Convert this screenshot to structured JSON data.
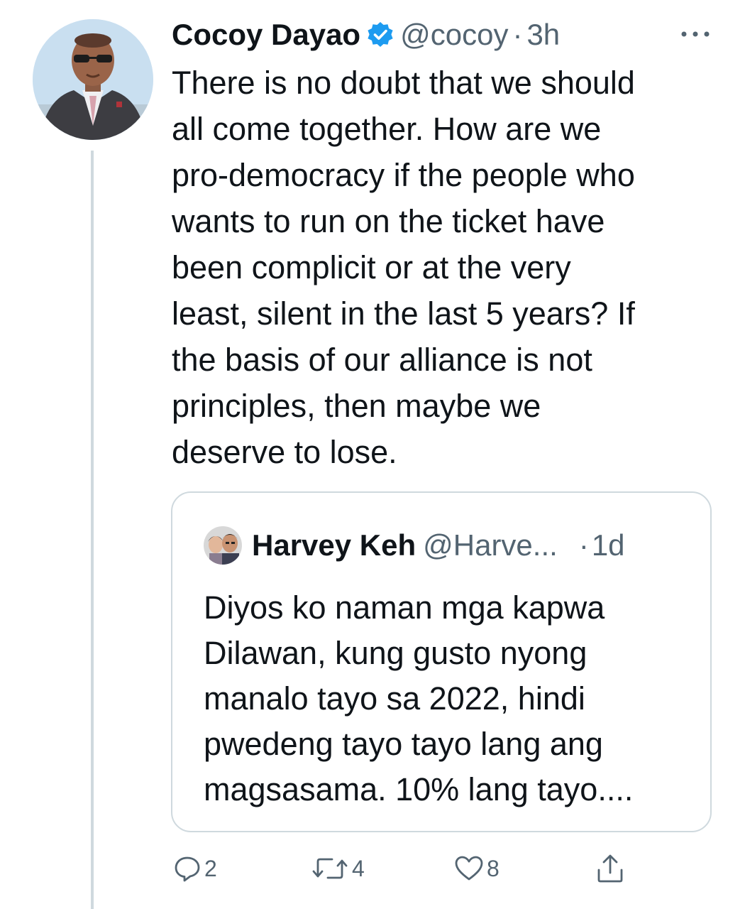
{
  "tweet": {
    "author": {
      "display_name": "Cocoy Dayao",
      "handle": "@cocoy",
      "verified": true
    },
    "separator": "·",
    "time": "3h",
    "text_lines": [
      "There is no doubt that we should",
      "all come together. How are we",
      "pro-democracy if the people who",
      "wants to run on the ticket have",
      "been complicit or at the very",
      "least, silent in the last 5 years? If",
      "the basis of our alliance is not",
      "principles, then maybe we",
      "deserve to lose."
    ],
    "quoted": {
      "display_name": "Harvey Keh",
      "handle": "@Harve...",
      "separator": "·",
      "time": "1d",
      "text_lines": [
        "Diyos ko naman mga kapwa",
        "Dilawan, kung gusto nyong",
        "manalo tayo sa 2022, hindi",
        "pwedeng tayo tayo lang ang",
        "magsasama. 10% lang tayo...."
      ]
    },
    "actions": {
      "reply_count": "2",
      "retweet_count": "4",
      "like_count": "8"
    }
  },
  "icons": {
    "verified": "verified-badge-icon",
    "more": "more-dots-icon",
    "reply": "reply-icon",
    "retweet": "retweet-icon",
    "like": "heart-icon",
    "share": "share-icon"
  },
  "colors": {
    "text": "#0f1419",
    "secondary": "#536471",
    "verified_blue": "#1d9bf0",
    "border": "#cfd9de"
  }
}
